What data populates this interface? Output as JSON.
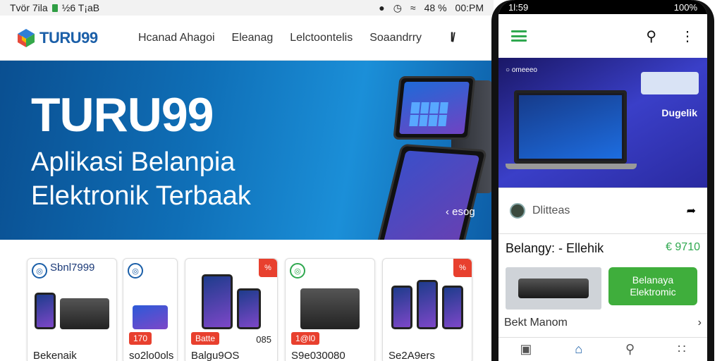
{
  "status": {
    "left_text": "Tvör 7ila",
    "mid_text": "½6 T¡aB",
    "battery": "48 %",
    "time": "00:PM"
  },
  "header": {
    "logo_text": "TURU99",
    "nav": [
      "Hcanad Ahagoi",
      "Eleanag",
      "Lelctoontelis",
      "Soaandrry"
    ],
    "nav_icon": "l̸"
  },
  "hero": {
    "title": "TURU99",
    "subtitle_line1": "Aplikasi Belanpia",
    "subtitle_line2": "Elektronik Terbaak",
    "back_link": "‹ esog"
  },
  "products": [
    {
      "corner": "Sbnl7999",
      "price": "",
      "price_right": "",
      "name": "Bekenaik"
    },
    {
      "corner": "",
      "price": "170",
      "price_right": "",
      "name": "so2lo0ols"
    },
    {
      "corner": "",
      "price": "Batte",
      "price_right": "085",
      "name": "Balgu9OS"
    },
    {
      "corner": "",
      "price": "1@l0",
      "price_right": "",
      "name": "S9e030080"
    },
    {
      "corner": "",
      "price": "",
      "price_right": "",
      "name": "Se2A9ers"
    }
  ],
  "phone": {
    "status_time": "1l:59",
    "status_battery": "100%",
    "banner_label": "○ omeeeo",
    "banner_brand": "Dugelik",
    "row_text": "Dlitteas",
    "section_title": "Belangy: - Ellehik",
    "section_value": "€ 9710",
    "button_text": "Belanaya Elektromic",
    "more_text": "Bekt Manom",
    "more_arrow": "›"
  },
  "colors": {
    "brand_blue": "#1b5fa8",
    "hero_blue": "#0f6fb7",
    "accent_green": "#3fae3c",
    "sale_red": "#e8402e"
  }
}
